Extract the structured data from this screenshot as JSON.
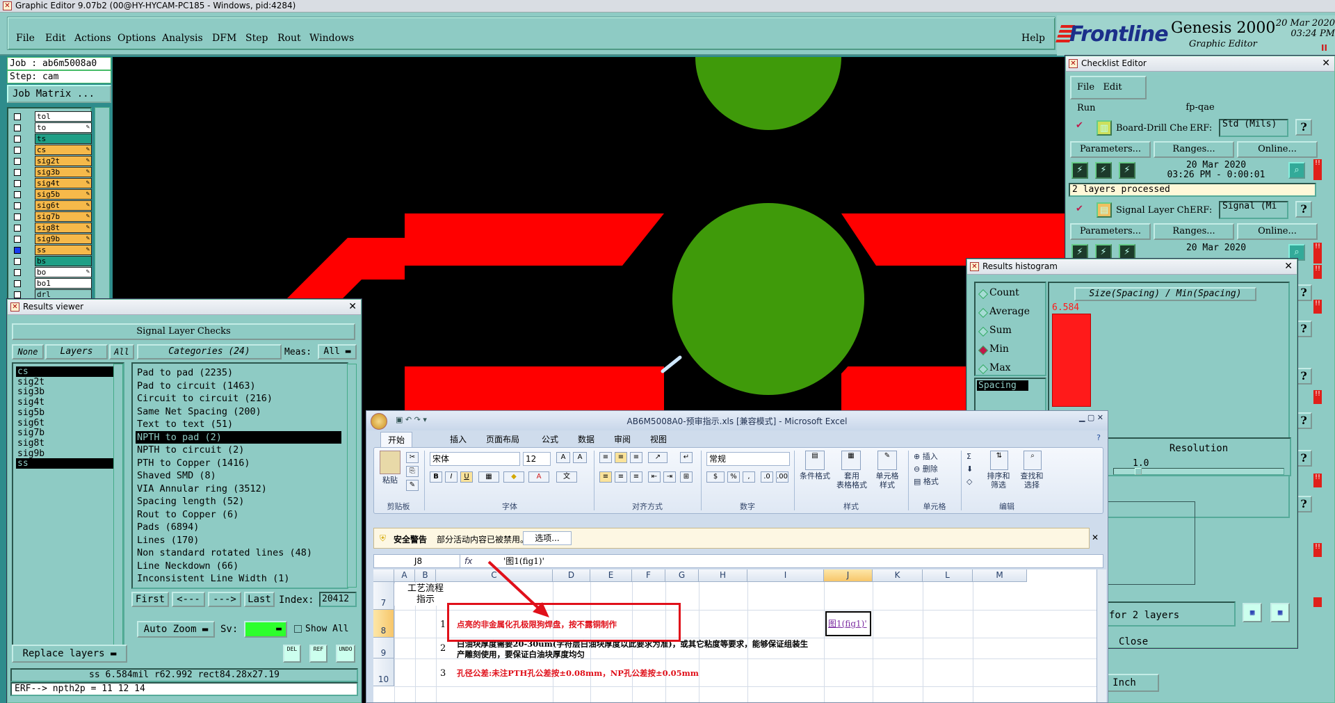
{
  "titlebar": {
    "title": "Graphic Editor 9.07b2 (00@HY-HYCAM-PC185 - Windows, pid:4284)"
  },
  "menu": {
    "items": [
      "File",
      "Edit",
      "Actions",
      "Options",
      "Analysis",
      "DFM",
      "Step",
      "Rout",
      "Windows"
    ],
    "help": "Help"
  },
  "brand": {
    "logo": "Frontline",
    "product": "Genesis 2000",
    "subtitle": "Graphic Editor",
    "date": "20 Mar 2020",
    "time": "03:24 PM",
    "pause": "II"
  },
  "job": {
    "job_line": "Job : ab6m5008a0",
    "step_line": "Step: cam",
    "matrix_button": "Job Matrix ..."
  },
  "layers": [
    {
      "name": "tol",
      "color": "#ffffff",
      "mark": false
    },
    {
      "name": "to",
      "color": "#ffffff",
      "mark": true
    },
    {
      "name": "ts",
      "color": "#1f9f86",
      "mark": false
    },
    {
      "name": "cs",
      "color": "#f6b94a",
      "mark": true
    },
    {
      "name": "sig2t",
      "color": "#f6b94a",
      "mark": true
    },
    {
      "name": "sig3b",
      "color": "#f6b94a",
      "mark": true
    },
    {
      "name": "sig4t",
      "color": "#f6b94a",
      "mark": true
    },
    {
      "name": "sig5b",
      "color": "#f6b94a",
      "mark": true
    },
    {
      "name": "sig6t",
      "color": "#f6b94a",
      "mark": true
    },
    {
      "name": "sig7b",
      "color": "#f6b94a",
      "mark": true
    },
    {
      "name": "sig8t",
      "color": "#f6b94a",
      "mark": true
    },
    {
      "name": "sig9b",
      "color": "#f6b94a",
      "mark": true
    },
    {
      "name": "ss",
      "color": "#f6b94a",
      "mark": true
    },
    {
      "name": "bs",
      "color": "#1f9f86",
      "mark": false
    },
    {
      "name": "bo",
      "color": "#ffffff",
      "mark": true
    },
    {
      "name": "bo1",
      "color": "#ffffff",
      "mark": false
    },
    {
      "name": "drl",
      "color": "#8ecbc4",
      "mark": false
    }
  ],
  "results_viewer": {
    "title": "Results viewer",
    "heading": "Signal Layer Checks",
    "none_btn": "None",
    "layers_label": "Layers",
    "all_btn": "All",
    "categories_label": "Categories (24)",
    "meas_label": "Meas:",
    "meas_value": "All",
    "layer_list": [
      "cs",
      "sig2t",
      "sig3b",
      "sig4t",
      "sig5b",
      "sig6t",
      "sig7b",
      "sig8t",
      "sig9b",
      "ss"
    ],
    "categories": [
      "Pad to pad (2235)",
      "Pad to circuit (1463)",
      "Circuit to circuit (216)",
      "Same Net Spacing (200)",
      "Text to text (51)",
      "NPTH to pad (2)",
      "NPTH to circuit (2)",
      "PTH to Copper (1416)",
      "Shaved SMD (8)",
      "VIA Annular ring (3512)",
      "Spacing length (52)",
      "Rout to Copper (6)",
      "Pads (6894)",
      "Lines (170)",
      "Non standard rotated lines (48)",
      "Line Neckdown (66)",
      "Inconsistent Line Width (1)"
    ],
    "nav": [
      "First",
      "<---",
      "--->",
      "Last"
    ],
    "index_label": "Index:",
    "index_value": "20412",
    "auto_zoom": "Auto Zoom",
    "sv_label": "Sv:",
    "show_all": "Show All",
    "replace_layers": "Replace layers",
    "icon_del": "DEL",
    "icon_ref": "REF",
    "icon_undo": "UNDO",
    "status1": "ss 6.584mil   r62.992   rect84.28x27.19",
    "status2": "ERF--> npth2p = 11 12 14"
  },
  "checklist": {
    "title": "Checklist Editor",
    "menu": [
      "File",
      "Edit",
      "Run"
    ],
    "name": "fp-qae",
    "rows": [
      {
        "title": "Board-Drill Che",
        "erf": "ERF:",
        "erf_value": "Std (Mils)",
        "date": "20 Mar 2020",
        "time": "03:26 PM - 0:00:01",
        "status": "2 layers processed"
      },
      {
        "title": "Signal Layer Ch",
        "erf": "ERF:",
        "erf_value": "Signal (Mi",
        "date": "20 Mar 2020",
        "time": "",
        "status": ""
      }
    ],
    "buttons": [
      "Parameters...",
      "Ranges...",
      "Online..."
    ],
    "for_layers": "for 2 layers",
    "close": "Close",
    "inch": "Inch"
  },
  "histogram": {
    "title": "Results histogram",
    "options": [
      "Count",
      "Average",
      "Sum",
      "Min",
      "Max"
    ],
    "selected": "Min",
    "measure": "Spacing",
    "chart_title": "Size(Spacing) / Min(Spacing)",
    "bar_label": "6.584",
    "resolution_label": "Resolution",
    "resolution_value": "1.0"
  },
  "excel": {
    "title": "AB6M5008A0-预审指示.xls  [兼容模式]  -  Microsoft Excel",
    "tabs": [
      "开始",
      "插入",
      "页面布局",
      "公式",
      "数据",
      "审阅",
      "视图"
    ],
    "font_name": "宋体",
    "font_size": "12",
    "number_format": "常规",
    "group_labels": [
      "剪贴板",
      "字体",
      "对齐方式",
      "数字",
      "样式",
      "单元格",
      "编辑"
    ],
    "buttons": {
      "paste": "粘贴",
      "cond_format": "条件格式",
      "table_format": "套用\n表格格式",
      "cell_style": "单元格\n样式",
      "insert": "插入",
      "delete": "删除",
      "format": "格式",
      "sort_filter": "排序和\n筛选",
      "find_select": "查找和\n选择"
    },
    "security_label": "安全警告",
    "security_text": "部分活动内容已被禁用。",
    "security_options": "选项...",
    "name_box": "J8",
    "formula": "'图1(fig1)'",
    "columns": [
      "A",
      "B",
      "C",
      "D",
      "E",
      "F",
      "G",
      "H",
      "I",
      "J",
      "K",
      "L",
      "M"
    ],
    "rows": [
      "7",
      "8",
      "9",
      "10"
    ],
    "row7_a": "工艺流程\n指示",
    "rows_data": [
      {
        "num": "1",
        "text": "点亮的非金属化孔极限狗焊盘，按不露铜制作",
        "color": "#e0101a"
      },
      {
        "num": "2",
        "text": "白油块厚度需要20-30um(字符层白油块厚度以此要求为准)，或其它粘度等要求，能够保证组装生\n产雕刻使用，要保证白油块厚度均匀",
        "color": "#000000"
      },
      {
        "num": "3",
        "text": "孔径公差:未注PTH孔公差按±0.08mm，NP孔公差按±0.05mm",
        "color": "#e0101a"
      }
    ],
    "j8": "图1(fig1)'"
  },
  "colors": {
    "panel": "#8ecbc4",
    "canvas": "#000000",
    "copper_red": "#ff0000",
    "pad_green": "#3f9a0a",
    "highlight_red": "#e0101a"
  }
}
